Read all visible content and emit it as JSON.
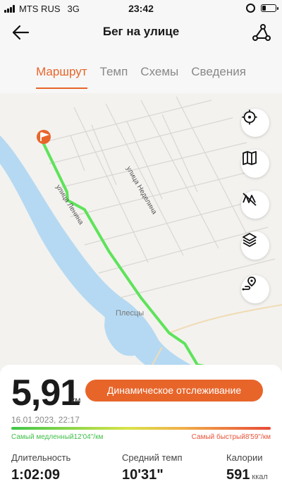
{
  "status_bar": {
    "carrier": "MTS RUS",
    "network": "3G",
    "time": "23:42"
  },
  "nav": {
    "title": "Бег на улице"
  },
  "tabs": [
    {
      "label": "Маршрут",
      "active": true
    },
    {
      "label": "Темп",
      "active": false
    },
    {
      "label": "Схемы",
      "active": false
    },
    {
      "label": "Сведения",
      "active": false
    }
  ],
  "map": {
    "labels": {
      "street1": "улица Ленина",
      "street2": "улица Неделина",
      "place": "Плесцы"
    },
    "route_color": "#5ee35a",
    "water_color": "#b5d9f2",
    "buttons": [
      "locate-icon",
      "map-icon",
      "no-route-icon",
      "layers-icon",
      "route-point-icon"
    ]
  },
  "summary": {
    "distance": "5,91",
    "distance_unit": "км",
    "dynamic_button": "Динамическое отслеживание",
    "date": "16.01.2023, 22:17",
    "slowest": "Самый медленный12'04\"/км",
    "fastest": "Самый быстрый8'59\"/км"
  },
  "stats": [
    {
      "label": "Длительность",
      "value": "1:02:09",
      "unit": ""
    },
    {
      "label": "Средний темп",
      "value": "10'31\"",
      "unit": ""
    },
    {
      "label": "Калории",
      "value": "591",
      "unit": "ккал"
    }
  ],
  "colors": {
    "accent": "#e8652a",
    "route": "#5ee35a"
  }
}
